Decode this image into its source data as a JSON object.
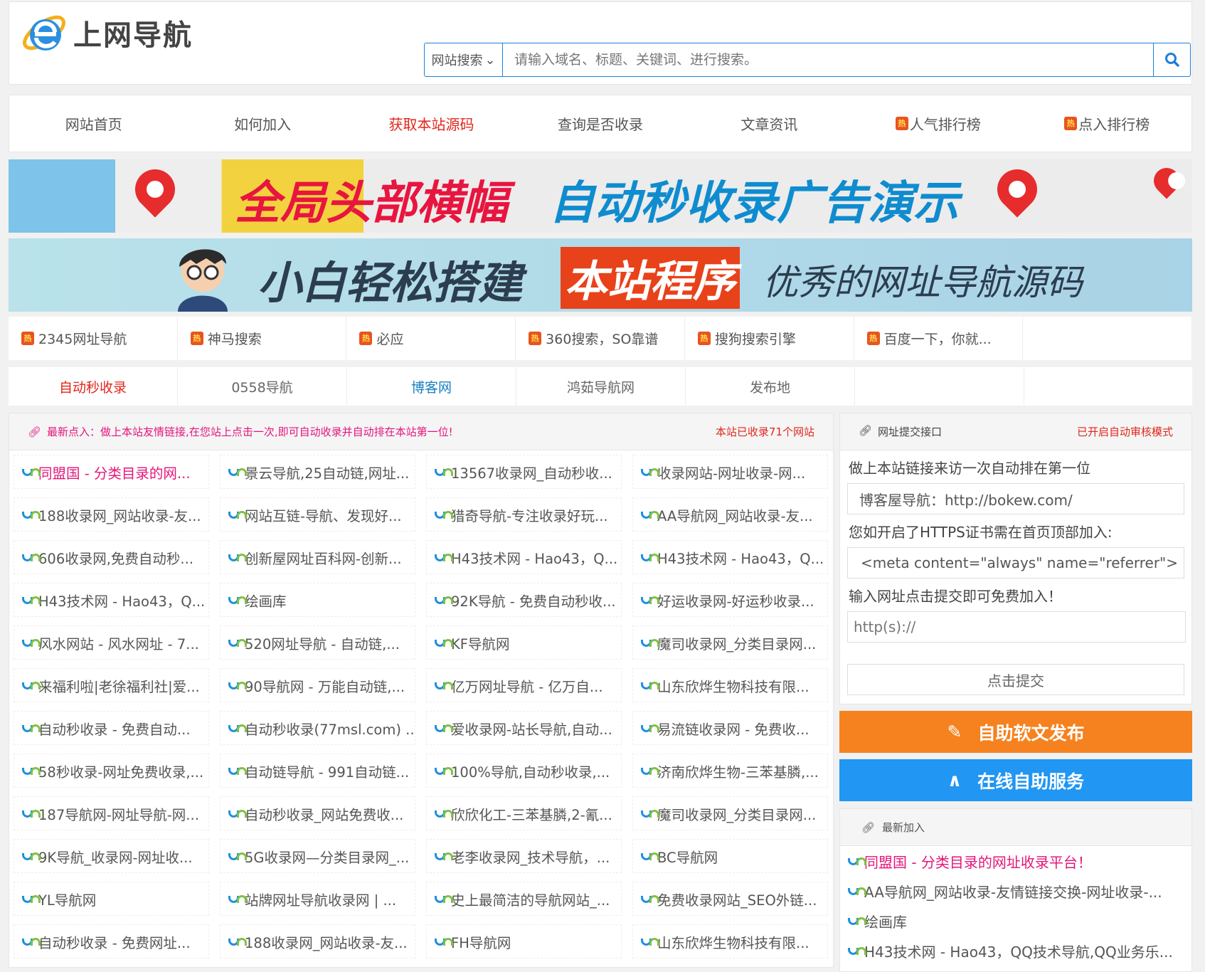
{
  "header": {
    "logo_text": "上网导航",
    "search_select": "网站搜索",
    "search_placeholder": "请输入域名、标题、关键词、进行搜索。"
  },
  "nav": [
    {
      "label": "网站首页"
    },
    {
      "label": "如何加入"
    },
    {
      "label": "获取本站源码",
      "color": "#e0261b"
    },
    {
      "label": "查询是否收录"
    },
    {
      "label": "文章资讯"
    },
    {
      "label": "人气排行榜",
      "hot": true
    },
    {
      "label": "点入排行榜",
      "hot": true
    }
  ],
  "hot_badge": "热",
  "banners": {
    "b1_left": "全局头部横幅",
    "b1_right": "自动秒收录广告演示",
    "b2_left": "小白轻松搭建",
    "b2_mid": "本站程序",
    "b2_right": "优秀的网址导航源码"
  },
  "hot_links": [
    "2345网址导航",
    "神马搜索",
    "必应",
    "360搜索，SO靠谱",
    "搜狗搜索引擎",
    "百度一下，你就..."
  ],
  "friend_links": [
    {
      "label": "自动秒收录",
      "color": "#e0261b"
    },
    {
      "label": "0558导航",
      "color": "#666"
    },
    {
      "label": "博客网",
      "color": "#1a7fc1"
    },
    {
      "label": "鸿茹导航网",
      "color": "#666"
    },
    {
      "label": "发布地",
      "color": "#666"
    }
  ],
  "main": {
    "notice": "最新点入：做上本站友情链接,在您站上点击一次,即可自动收录并自动排在本站第一位!",
    "count": "本站已收录71个网站",
    "sites": [
      "同盟国 - 分类目录的网...",
      "景云导航,25自动链,网址...",
      "13567收录网_自动秒收...",
      "收录网站-网址收录-网...",
      "188收录网_网站收录-友...",
      "网站互链-导航、发现好...",
      "猎奇导航-专注收录好玩...",
      "AA导航网_网站收录-友...",
      "606收录网,免费自动秒...",
      "创新屋网址百科网-创新...",
      "H43技术网 - Hao43，Q...",
      "H43技术网 - Hao43，Q...",
      "H43技术网 - Hao43，Q...",
      "绘画库",
      "92K导航 - 免费自动秒收...",
      "好运收录网-好运秒收录...",
      "风水网站 - 风水网址 - 7...",
      "520网址导航 - 自动链,...",
      "KF导航网",
      "魔司收录网_分类目录网...",
      "来福利啦|老徐福利社|爱...",
      "90导航网 - 万能自动链,...",
      "亿万网址导航 - 亿万自...",
      "山东欣烨生物科技有限...",
      "自动秒收录 - 免费自动...",
      "自动秒收录(77msl.com) ...",
      "爱收录网-站长导航,自动...",
      "易流链收录网 - 免费收...",
      "58秒收录-网址免费收录,...",
      "自动链导航 - 991自动链...",
      "100%导航,自动秒收录,...",
      "济南欣烨生物-三苯基膦,...",
      "187导航网-网址导航-网...",
      "自动秒收录_网站免费收...",
      "欣欣化工-三苯基膦,2-氰...",
      "魔司收录网_分类目录网...",
      "9K导航_收录网-网址收...",
      "5G收录网—分类目录网_...",
      "老李收录网_技术导航，...",
      "BC导航网",
      "YL导航网",
      "站牌网址导航收录网 | ...",
      "史上最简洁的导航网站_...",
      "免费收录网站_SEO外链...",
      "自动秒收录 - 免费网址...",
      "188收录网_网站收录-友...",
      "FH导航网",
      "山东欣烨生物科技有限..."
    ]
  },
  "submit": {
    "title": "网址提交接口",
    "mode": "已开启自动审核模式",
    "line1": "做上本站链接来访一次自动排在第一位",
    "example": "博客屋导航：http://bokew.com/",
    "line2": "您如开启了HTTPS证书需在首页顶部加入:",
    "meta": "<meta content=\"always\" name=\"referrer\">",
    "line3": "输入网址点击提交即可免费加入！",
    "url_placeholder": "http(s)://",
    "submit_label": "点击提交"
  },
  "buttons": {
    "publish": "自助软文发布",
    "service": "在线自助服务"
  },
  "recent": {
    "title": "最新加入",
    "items": [
      "同盟国 - 分类目录的网址收录平台！",
      "AA导航网_网站收录-友情链接交换-网址收录-...",
      "绘画库",
      "H43技术网 - Hao43，QQ技术导航,QQ业务乐..."
    ]
  },
  "colors": {
    "accent": "#1e7fd8",
    "pink": "#e4157a",
    "red": "#e0261b",
    "orange": "#f5821f",
    "blue": "#2196f3"
  }
}
